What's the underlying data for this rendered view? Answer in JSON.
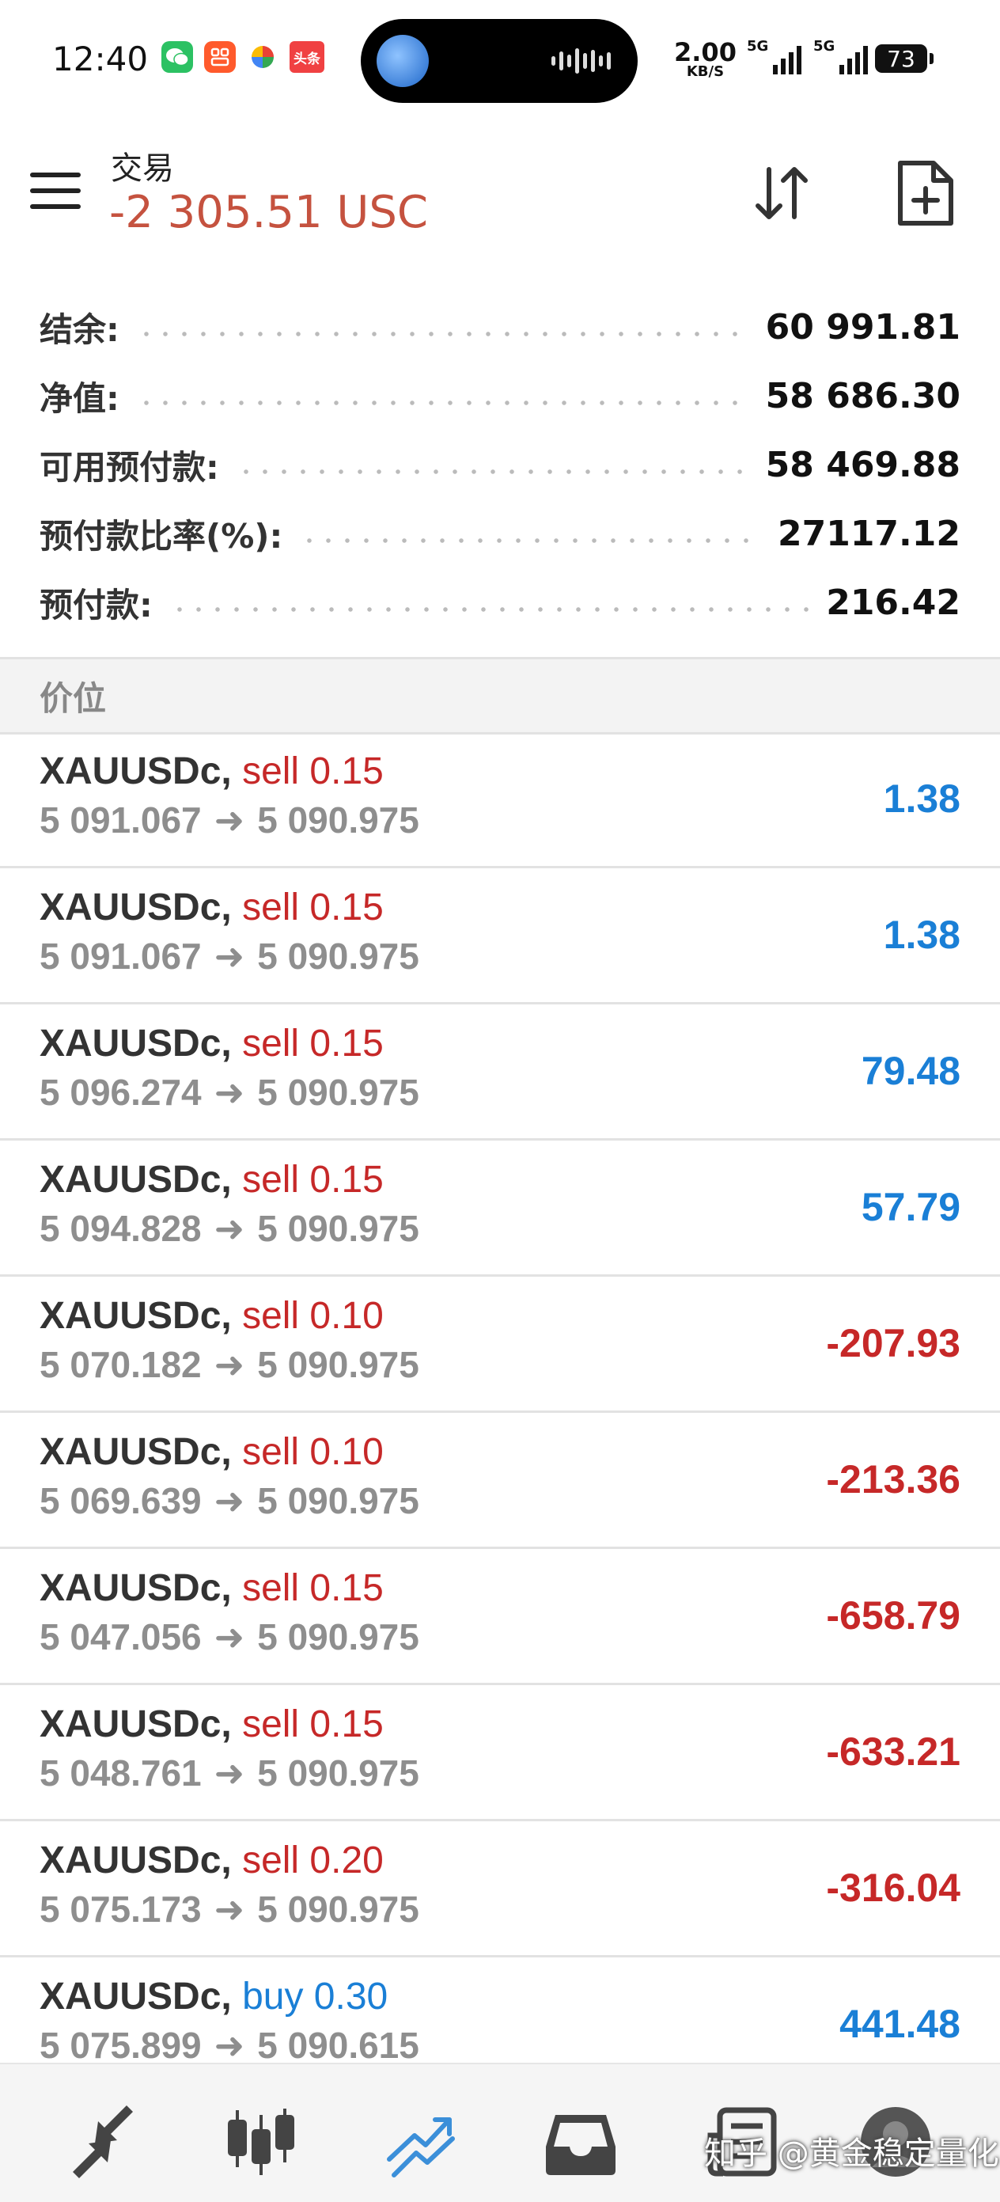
{
  "status_bar": {
    "time": "12:40",
    "net_speed_value": "2.00",
    "net_speed_unit": "KB/S",
    "signal1_label": "5G",
    "signal2_label": "5G",
    "battery": "73",
    "app_icons": [
      "wechat-icon",
      "taobao-icon",
      "pinwheel-icon",
      "toutiao-icon"
    ],
    "toutiao_label": "头条"
  },
  "header": {
    "title": "交易",
    "profit": "-2 305.51 USC",
    "profit_color": "#c5523f"
  },
  "summary": [
    {
      "label": "结余:",
      "value": "60 991.81"
    },
    {
      "label": "净值:",
      "value": "58 686.30"
    },
    {
      "label": "可用预付款:",
      "value": "58 469.88"
    },
    {
      "label": "预付款比率(%):",
      "value": "27117.12"
    },
    {
      "label": "预付款:",
      "value": "216.42"
    }
  ],
  "section": {
    "label": "价位"
  },
  "positions": [
    {
      "symbol": "XAUUSDc,",
      "side": "sell",
      "volume": "sell 0.15",
      "open": "5 091.067",
      "current": "5 090.975",
      "profit": "1.38",
      "profit_sign": "pos"
    },
    {
      "symbol": "XAUUSDc,",
      "side": "sell",
      "volume": "sell 0.15",
      "open": "5 091.067",
      "current": "5 090.975",
      "profit": "1.38",
      "profit_sign": "pos"
    },
    {
      "symbol": "XAUUSDc,",
      "side": "sell",
      "volume": "sell 0.15",
      "open": "5 096.274",
      "current": "5 090.975",
      "profit": "79.48",
      "profit_sign": "pos"
    },
    {
      "symbol": "XAUUSDc,",
      "side": "sell",
      "volume": "sell 0.15",
      "open": "5 094.828",
      "current": "5 090.975",
      "profit": "57.79",
      "profit_sign": "pos"
    },
    {
      "symbol": "XAUUSDc,",
      "side": "sell",
      "volume": "sell 0.10",
      "open": "5 070.182",
      "current": "5 090.975",
      "profit": "-207.93",
      "profit_sign": "neg"
    },
    {
      "symbol": "XAUUSDc,",
      "side": "sell",
      "volume": "sell 0.10",
      "open": "5 069.639",
      "current": "5 090.975",
      "profit": "-213.36",
      "profit_sign": "neg"
    },
    {
      "symbol": "XAUUSDc,",
      "side": "sell",
      "volume": "sell 0.15",
      "open": "5 047.056",
      "current": "5 090.975",
      "profit": "-658.79",
      "profit_sign": "neg"
    },
    {
      "symbol": "XAUUSDc,",
      "side": "sell",
      "volume": "sell 0.15",
      "open": "5 048.761",
      "current": "5 090.975",
      "profit": "-633.21",
      "profit_sign": "neg"
    },
    {
      "symbol": "XAUUSDc,",
      "side": "sell",
      "volume": "sell 0.20",
      "open": "5 075.173",
      "current": "5 090.975",
      "profit": "-316.04",
      "profit_sign": "neg"
    },
    {
      "symbol": "XAUUSDc,",
      "side": "buy",
      "volume": "buy 0.30",
      "open": "5 075.899",
      "current": "5 090.615",
      "profit": "441.48",
      "profit_sign": "pos"
    }
  ],
  "colors": {
    "profit_positive": "#1a7fd6",
    "profit_negative": "#c62828",
    "nav_active": "#3b8fd9"
  },
  "bottom_nav": {
    "items": [
      "quotes-icon",
      "chart-icon",
      "trade-icon",
      "history-icon",
      "news-icon",
      "avatar-icon"
    ],
    "active": "trade-icon"
  },
  "watermark": "知乎 @黄金稳定量化"
}
